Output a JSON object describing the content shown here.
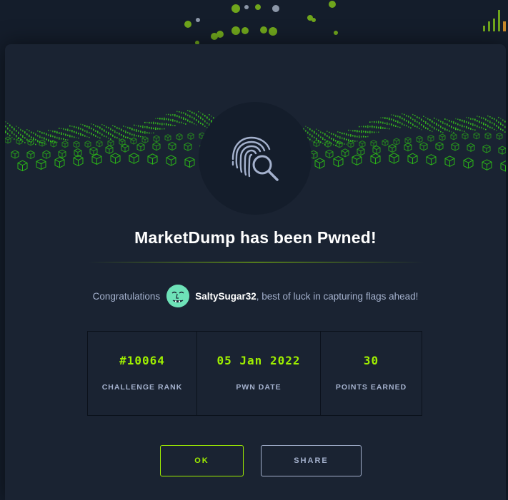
{
  "modal": {
    "title": "MarketDump has been Pwned!",
    "congrats_prefix": "Congratulations",
    "username": "SaltySugar32",
    "congrats_suffix": ", best of luck in capturing flags ahead!",
    "stats": [
      {
        "value": "#10064",
        "label": "CHALLENGE RANK"
      },
      {
        "value": "05 Jan 2022",
        "label": "PWN DATE"
      },
      {
        "value": "30",
        "label": "POINTS EARNED"
      }
    ],
    "ok_label": "OK",
    "share_label": "SHARE",
    "badge_icon": "fingerprint-search-icon"
  },
  "colors": {
    "accent": "#9fef00",
    "modal_bg": "#1a2332",
    "page_bg": "#141d2b",
    "text_muted": "#a4b1cd"
  }
}
